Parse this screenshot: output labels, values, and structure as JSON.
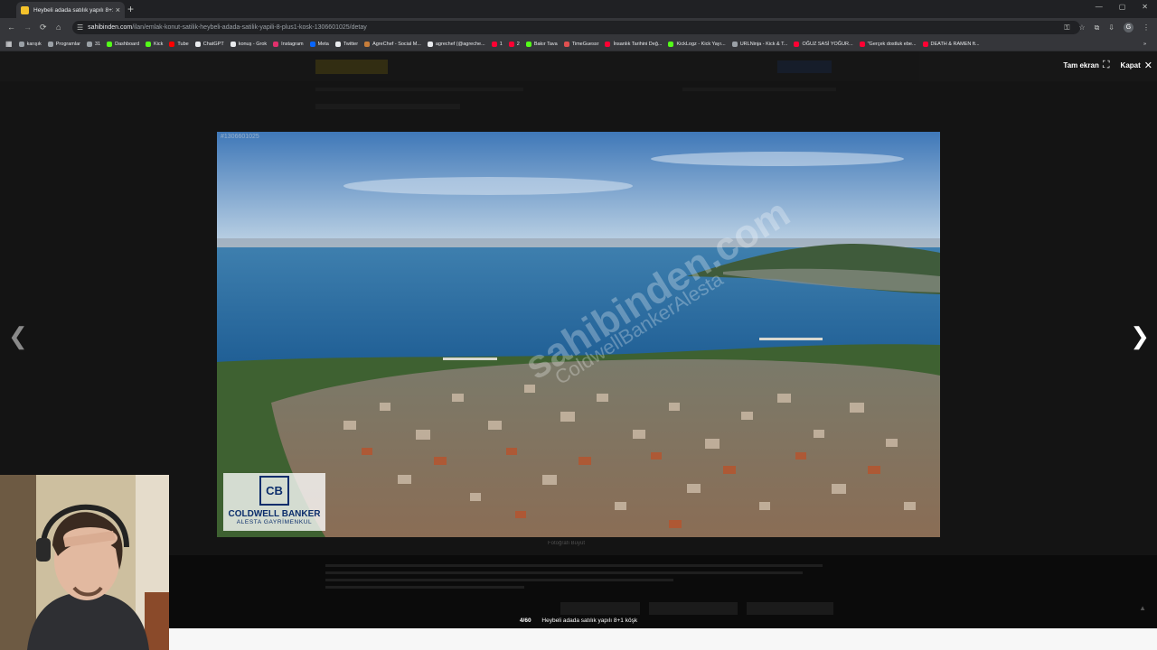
{
  "browser": {
    "tab_title": "Heybeli adada satılık yapılı 8+1",
    "tab_close": "×",
    "newtab": "+",
    "url_domain": "sahibinden.com",
    "url_path": "/ilan/emlak-konut-satilik-heybeli-adada-satilik-yapili-8-plus1-kosk-1306601025/detay",
    "bookmarks": [
      {
        "label": "karışık",
        "color": "#9aa0a6"
      },
      {
        "label": "Programlar",
        "color": "#9aa0a6"
      },
      {
        "label": "31",
        "color": "#9aa0a6"
      },
      {
        "label": "Dashboard",
        "color": "#53fc18"
      },
      {
        "label": "Kick",
        "color": "#53fc18"
      },
      {
        "label": "Tube",
        "color": "#ff0000"
      },
      {
        "label": "ChatGPT",
        "color": "#e8eaed"
      },
      {
        "label": "konuş - Grok",
        "color": "#e8eaed"
      },
      {
        "label": "Instagram",
        "color": "#e1306c"
      },
      {
        "label": "Meta",
        "color": "#0866ff"
      },
      {
        "label": "Twitter",
        "color": "#e8eaed"
      },
      {
        "label": "AgreChef - Social M...",
        "color": "#c77d3a"
      },
      {
        "label": "agrechef (@agreche...",
        "color": "#e8eaed"
      },
      {
        "label": "1",
        "color": "#ff0033"
      },
      {
        "label": "2",
        "color": "#ff0033"
      },
      {
        "label": "Bakır Tava",
        "color": "#53fc18"
      },
      {
        "label": "TimeGuessr",
        "color": "#e05050"
      },
      {
        "label": "İnsanlık Tarihini Değ...",
        "color": "#ff0033"
      },
      {
        "label": "KickLogz - Kick Yayı...",
        "color": "#53fc18"
      },
      {
        "label": "URLNinja - Kick & T...",
        "color": "#9aa0a6"
      },
      {
        "label": "OĞUZ SASİ YOĞUR...",
        "color": "#ff0033"
      },
      {
        "label": "\"Gerçek dostluk ebe...",
        "color": "#ff0033"
      },
      {
        "label": "DEATH & RAMEN ft...",
        "color": "#ff0033"
      }
    ]
  },
  "lightbox": {
    "fullscreen_label": "Tam ekran",
    "close_label": "Kapat",
    "listing_number": "#1306601025",
    "watermark_main": "sahibinden.com",
    "watermark_sub": "ColdwellBankerAlesta",
    "agency_mark": "CB",
    "agency_name": "COLDWELL BANKER",
    "agency_sub": "ALESTA GAYRİMENKUL",
    "counter": "4/60",
    "caption": "Heybeli adada satılık yapılı 8+1 köşk",
    "under_note": "Fotoğrafı Büyüt"
  }
}
